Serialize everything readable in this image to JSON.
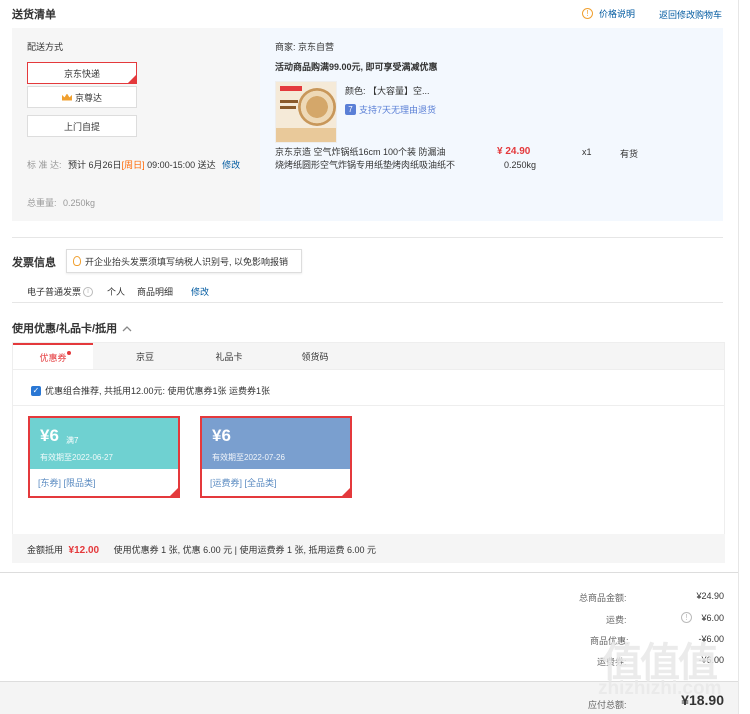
{
  "delivery": {
    "title": "送货清单",
    "price_note": "价格说明",
    "back_link": "返回修改购物车",
    "method_title": "配送方式",
    "options": [
      "京东快递",
      "京尊达",
      "上门自提"
    ],
    "standard_label": "标 准 达:",
    "standard_date": "预计 6月26日",
    "standard_weekday": "[周日]",
    "standard_time": "09:00-15:00 送达",
    "modify": "修改",
    "weight_label": "总重量:",
    "weight_value": "0.250kg"
  },
  "merchant": {
    "label": "商家:",
    "name": "京东自营",
    "promo": "活动商品购满99.00元, 即可享受满减优惠",
    "color_label": "颜色:",
    "color_value": "【大容量】空...",
    "return_badge": "支持7天无理由退货",
    "product_name_line1": "京东京造 空气炸锅纸16cm 100个装 防漏油",
    "product_name_line2": "烧烤纸圆形空气炸锅专用纸垫烤肉纸吸油纸不",
    "price": "¥ 24.90",
    "weight": "0.250kg",
    "qty": "x1",
    "stock": "有货"
  },
  "invoice": {
    "title": "发票信息",
    "tip": "开企业抬头发票须填写纳税人识别号, 以免影响报销",
    "type": "电子普通发票",
    "holder": "个人",
    "content": "商品明细",
    "modify": "修改"
  },
  "discount": {
    "title": "使用优惠/礼品卡/抵用",
    "tabs": [
      "优惠券",
      "京豆",
      "礼品卡",
      "领货码"
    ],
    "recommend": "优惠组合推荐, 共抵用12.00元: 使用优惠券1张 运费券1张",
    "coupons": [
      {
        "amount": "¥6",
        "cond": "满7",
        "expire": "有效期至2022-06-27",
        "tag1": "[东券]",
        "tag2": "[限品类]",
        "color": "#6fd1d1"
      },
      {
        "amount": "¥6",
        "cond": "",
        "expire": "有效期至2022-07-26",
        "tag1": "[运费券]",
        "tag2": "[全品类]",
        "color": "#7a9fcf"
      }
    ],
    "summary_label": "金额抵用",
    "summary_amount": "¥12.00",
    "summary_detail": "使用优惠券 1 张, 优惠 6.00 元 | 使用运费券 1 张, 抵用运费 6.00 元"
  },
  "totals": {
    "goods_label": "总商品金额:",
    "goods_value": "¥24.90",
    "freight_label": "运费:",
    "freight_value": "¥6.00",
    "discount_label": "商品优惠:",
    "discount_value": "-¥6.00",
    "freight_coupon_label": "运费券:",
    "freight_coupon_value": "-¥6.00",
    "pay_label": "应付总额:",
    "pay_value": "¥18.90"
  },
  "watermark": {
    "text": "值值值",
    "domain": "zhizhizhi.com"
  },
  "colors": {
    "accent": "#e4393c",
    "link": "#005aa0",
    "orange": "#ff6600"
  }
}
